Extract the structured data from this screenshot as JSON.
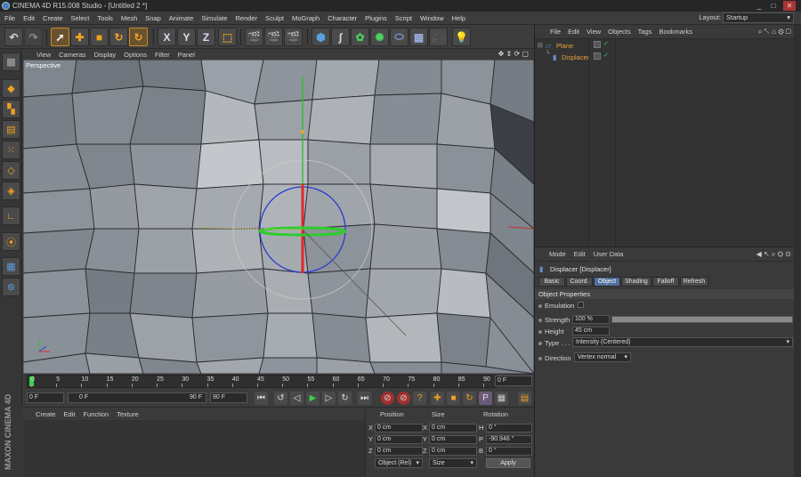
{
  "window": {
    "title": "CINEMA 4D R15.008 Studio - [Untitled 2 *]",
    "controls": [
      "_",
      "□",
      "✕"
    ]
  },
  "menubar": {
    "items": [
      "File",
      "Edit",
      "Create",
      "Select",
      "Tools",
      "Mesh",
      "Snap",
      "Animate",
      "Simulate",
      "Render",
      "Sculpt",
      "MoGraph",
      "Character",
      "Plugins",
      "Script",
      "Window",
      "Help"
    ],
    "layout_label": "Layout:",
    "layout_value": "Startup"
  },
  "toolbar": {
    "axis_x": "X",
    "axis_y": "Y",
    "axis_z": "Z"
  },
  "viewport": {
    "menu": [
      "View",
      "Cameras",
      "Display",
      "Options",
      "Filter",
      "Panel"
    ],
    "label": "Perspective"
  },
  "timeline": {
    "ticks": [
      "0",
      "5",
      "10",
      "15",
      "20",
      "25",
      "30",
      "35",
      "40",
      "45",
      "50",
      "55",
      "60",
      "65",
      "70",
      "75",
      "80",
      "85",
      "90"
    ],
    "current_frame": "0 F"
  },
  "transport": {
    "start_field": "0 F",
    "range_start": "0 F",
    "range_end": "90 F",
    "end_field": "90 F"
  },
  "material_manager": {
    "menu": [
      "Create",
      "Edit",
      "Function",
      "Texture"
    ]
  },
  "coordinates": {
    "headers": {
      "position": "Position",
      "size": "Size",
      "rotation": "Rotation"
    },
    "rows": [
      {
        "axis": "X",
        "pos": "0 cm",
        "size_axis": "X",
        "size": "0 cm",
        "rot_axis": "H",
        "rot": "0 °"
      },
      {
        "axis": "Y",
        "pos": "0 cm",
        "size_axis": "Y",
        "size": "0 cm",
        "rot_axis": "P",
        "rot": "-90.946 °"
      },
      {
        "axis": "Z",
        "pos": "0 cm",
        "size_axis": "Z",
        "size": "0 cm",
        "rot_axis": "B",
        "rot": "0 °"
      }
    ],
    "mode_select": "Object (Rel)",
    "size_select": "Size",
    "apply_label": "Apply"
  },
  "branding": {
    "text": "MAXON CINEMA 4D"
  },
  "object_manager": {
    "menu": [
      "File",
      "Edit",
      "View",
      "Objects",
      "Tags",
      "Bookmarks"
    ],
    "objects": [
      {
        "name": "Plane",
        "color": "#e8a33a"
      },
      {
        "name": "Displacer",
        "color": "#e8a33a"
      }
    ]
  },
  "attributes": {
    "menu": [
      "Mode",
      "Edit",
      "User Data"
    ],
    "object_title": "Displacer [Displacer]",
    "tabs": [
      "Basic",
      "Coord.",
      "Object",
      "Shading",
      "Falloff",
      "Refresh"
    ],
    "active_tab": "Object",
    "section": "Object Properties",
    "emulation_label": "Emulation",
    "strength_label": "Strength",
    "strength_value": "100 %",
    "strength_fraction": 1.0,
    "height_label": "Height",
    "height_value": "45 cm",
    "type_label": "Type . . .",
    "type_value": "Intensity (Centered)",
    "direction_label": "Direction",
    "direction_value": "Vertex normal"
  },
  "colors": {
    "accent_orange": "#e8a33a",
    "active_tab_blue": "#4f6f9a",
    "axis_x": "#e03030",
    "axis_y": "#30c030",
    "axis_z": "#3040e0"
  }
}
